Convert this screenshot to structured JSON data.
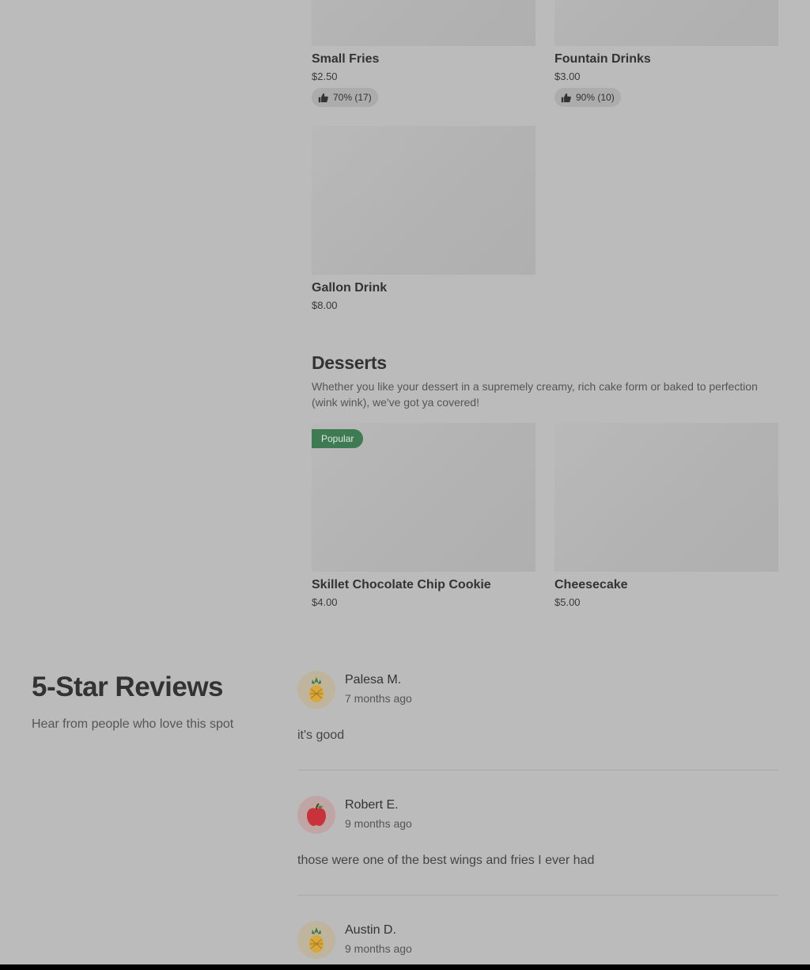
{
  "drinks": [
    {
      "name": "Small Fries",
      "price": "$2.50",
      "rating": "70% (17)"
    },
    {
      "name": "Fountain Drinks",
      "price": "$3.00",
      "rating": "90% (10)"
    },
    {
      "name": "Gallon Drink",
      "price": "$8.00"
    }
  ],
  "desserts": {
    "title": "Desserts",
    "description": "Whether you like your dessert in a supremely creamy, rich cake form or baked to perfection (wink wink), we've got ya covered!",
    "items": [
      {
        "name": "Skillet Chocolate Chip Cookie",
        "price": "$4.00",
        "badge": "Popular"
      },
      {
        "name": "Cheesecake",
        "price": "$5.00"
      }
    ]
  },
  "reviews": {
    "title": "5-Star Reviews",
    "subtitle": "Hear from people who love this spot",
    "items": [
      {
        "name": "Palesa M.",
        "time": "7 months ago",
        "text": "it's good",
        "avatar": "pineapple-icon"
      },
      {
        "name": "Robert E.",
        "time": "9 months ago",
        "text": "those were one of the best wings and fries I ever had",
        "avatar": "apple-icon"
      },
      {
        "name": "Austin D.",
        "time": "9 months ago",
        "avatar": "pineapple-icon"
      }
    ]
  },
  "colors": {
    "overlay": "#bbbbbb",
    "badge": "#3f7b52"
  }
}
